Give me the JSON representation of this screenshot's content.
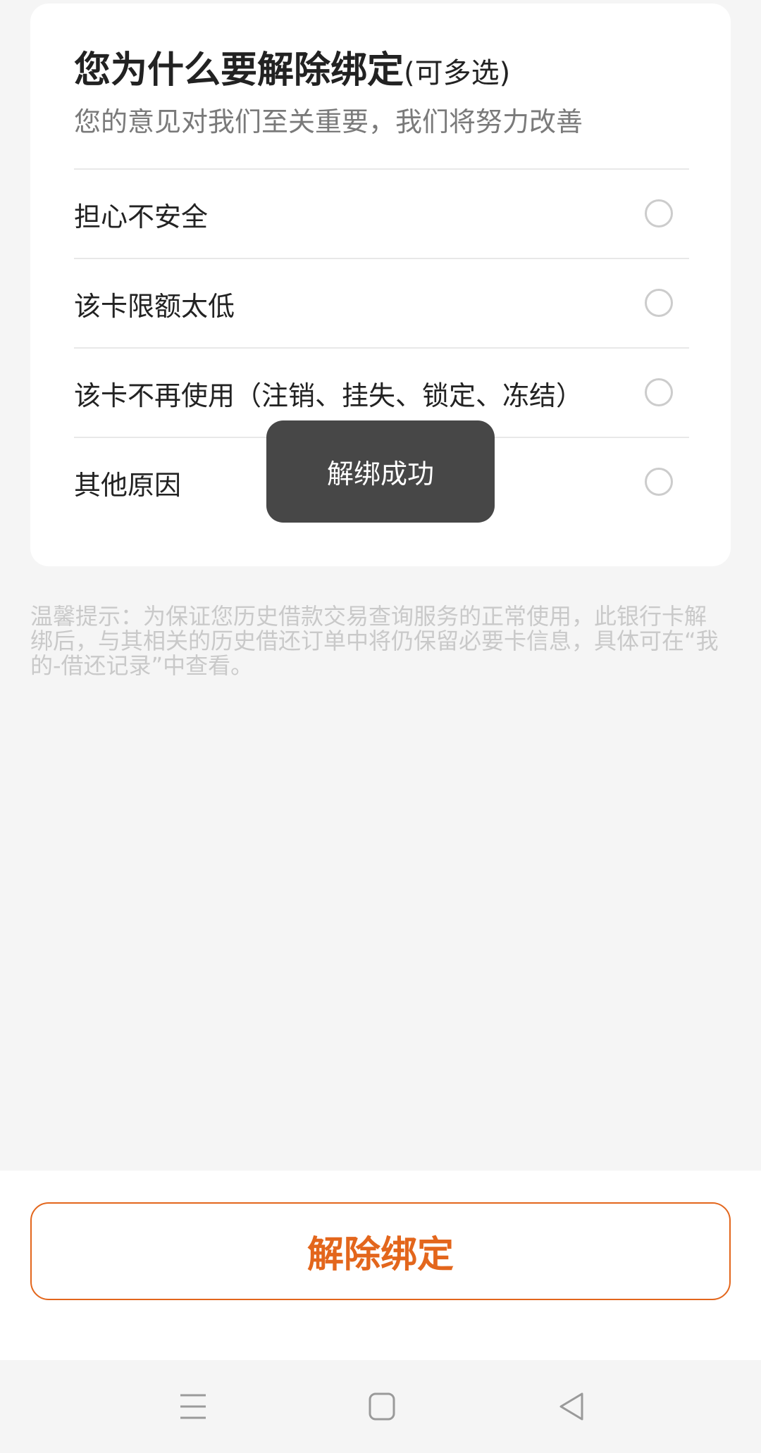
{
  "card": {
    "title": "您为什么要解除绑定",
    "title_hint": "(可多选)",
    "subtitle": "您的意见对我们至关重要，我们将努力改善",
    "options": [
      {
        "label": "担心不安全"
      },
      {
        "label": "该卡限额太低"
      },
      {
        "label": "该卡不再使用（注销、挂失、锁定、冻结）"
      },
      {
        "label": "其他原因"
      }
    ]
  },
  "tip": "温馨提示：为保证您历史借款交易查询服务的正常使用，此银行卡解绑后，与其相关的历史借还订单中将仍保留必要卡信息，具体可在“我的-借还记录”中查看。",
  "toast": "解绑成功",
  "action": {
    "label": "解除绑定"
  },
  "colors": {
    "accent": "#e3661c",
    "toast_bg": "#474747",
    "background": "#f5f5f5"
  },
  "navbar": {
    "icons": [
      "menu-icon",
      "home-icon",
      "back-icon"
    ]
  }
}
